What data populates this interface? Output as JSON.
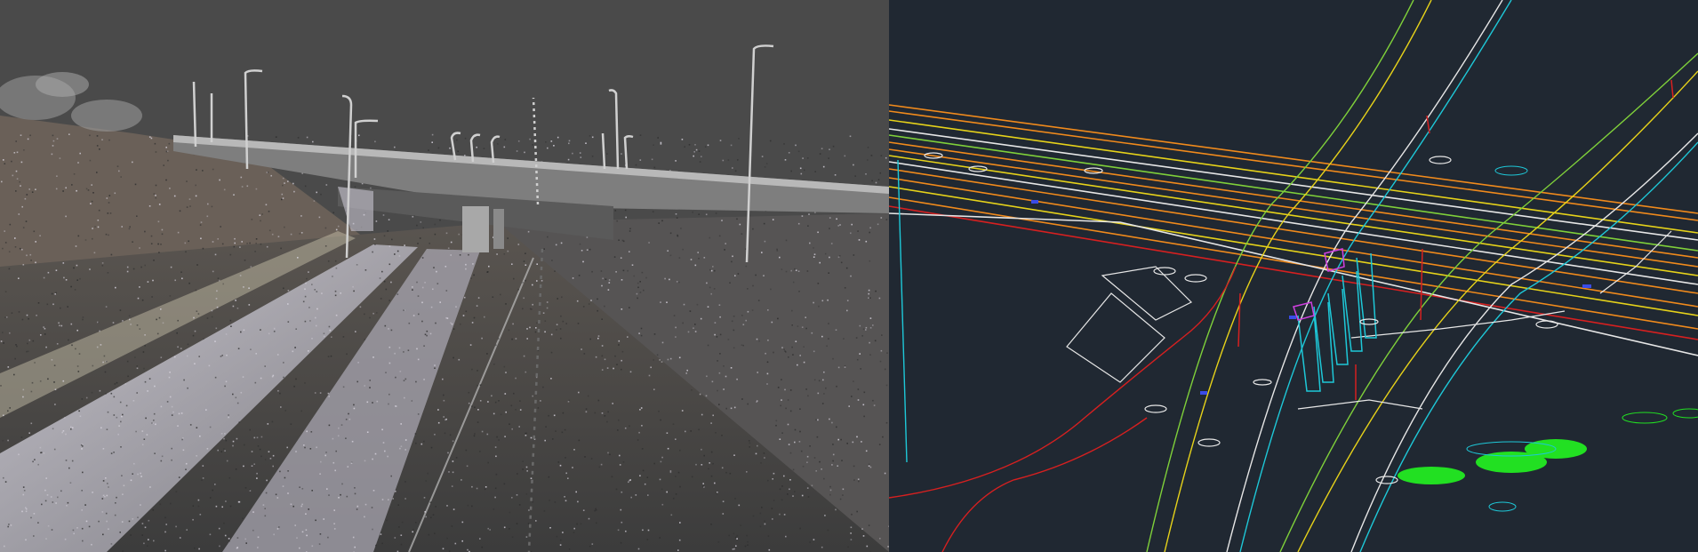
{
  "viewer": {
    "left_pane": {
      "view": "point-cloud-scan",
      "background": "#4a4a4a"
    },
    "right_pane": {
      "view": "cad-linework",
      "background": "#202832"
    }
  },
  "colors": {
    "point_cloud_light": "#d8d4de",
    "point_cloud_dark": "#2e2e2e",
    "bridge_deck": "#9a9a9a",
    "cad_white": "#e6e6e6",
    "cad_orange": "#f08a1c",
    "cad_yellow": "#e6d21a",
    "cad_green": "#7fd03a",
    "cad_red": "#d62020",
    "cad_cyan": "#1ec8d8",
    "cad_magenta": "#d040e0",
    "cad_blue": "#3a4ce8",
    "cad_bright_green": "#22e022"
  }
}
